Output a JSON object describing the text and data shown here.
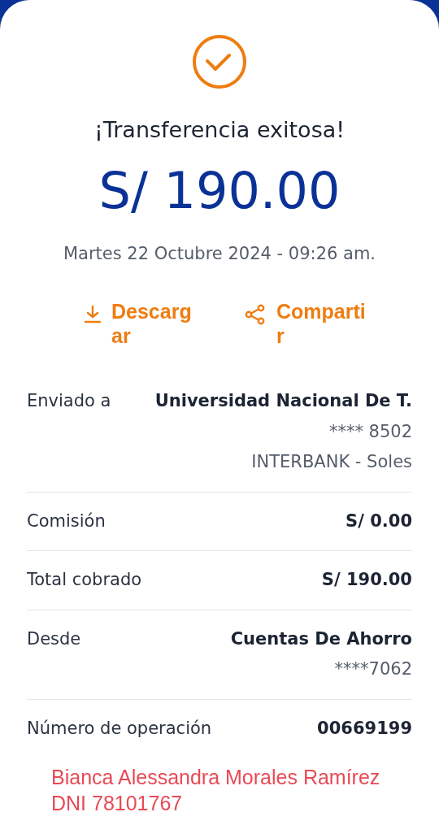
{
  "title": "¡Transferencia exitosa!",
  "amount": "S/ 190.00",
  "date": "Martes 22 Octubre 2024 - 09:26 am.",
  "actions": [
    {
      "kind": "download",
      "label": "Descargar"
    },
    {
      "kind": "share",
      "label": "Compartir"
    }
  ],
  "details": [
    {
      "label": "Enviado a",
      "values": [
        {
          "text": "Universidad Nacional De T.",
          "bold": true
        },
        {
          "text": "**** 8502",
          "bold": false
        },
        {
          "text": "INTERBANK - Soles",
          "bold": false
        }
      ]
    },
    {
      "label": "Comisión",
      "values": [
        {
          "text": "S/ 0.00",
          "bold": true
        }
      ]
    },
    {
      "label": "Total cobrado",
      "values": [
        {
          "text": "S/ 190.00",
          "bold": true
        }
      ]
    },
    {
      "label": "Desde",
      "values": [
        {
          "text": "Cuentas De Ahorro",
          "bold": true
        },
        {
          "text": "****7062",
          "bold": false
        }
      ]
    },
    {
      "label": "Número de operación",
      "values": [
        {
          "text": "00669199",
          "bold": true
        }
      ]
    }
  ],
  "annotation": [
    "Bianca Alessandra Morales Ramírez",
    "DNI 78101767"
  ]
}
